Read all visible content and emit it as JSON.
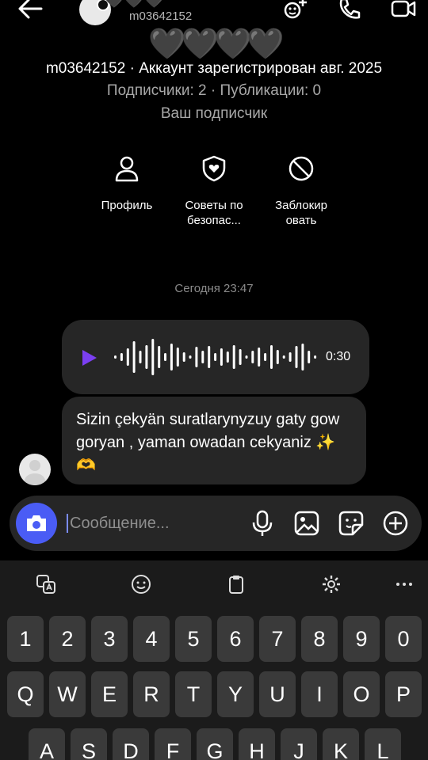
{
  "header": {
    "username_small": "m03642152",
    "top_hearts": "🖤🖤🖤",
    "name_hearts": [
      "🖤",
      "🖤",
      "🖤",
      "🖤"
    ]
  },
  "profile": {
    "account_line": "m03642152 · Аккаунт зарегистрирован авг. 2025",
    "stats_line": "Подписчики: 2 · Публикации: 0",
    "relation": "Ваш подписчик"
  },
  "actions": [
    {
      "label": "Профиль",
      "icon": "person-icon"
    },
    {
      "label": "Советы по безопас...",
      "icon": "shield-heart-icon"
    },
    {
      "label": "Заблокир овать",
      "icon": "block-icon"
    }
  ],
  "chat": {
    "timestamp": "Сегодня 23:47",
    "voice_duration": "0:30",
    "message": "Sizin çekyän suratlarynyzuy gaty gow goryan , yaman owadan cekyaniz ✨🫶"
  },
  "composer": {
    "placeholder": "Сообщение..."
  },
  "keyboard": {
    "tools": [
      "translate-icon",
      "emoji-icon",
      "clipboard-icon",
      "settings-icon",
      "more-icon"
    ],
    "row_numbers": [
      "1",
      "2",
      "3",
      "4",
      "5",
      "6",
      "7",
      "8",
      "9",
      "0"
    ],
    "row_top": [
      "Q",
      "W",
      "E",
      "R",
      "T",
      "Y",
      "U",
      "I",
      "O",
      "P"
    ],
    "row_middle": [
      "A",
      "S",
      "D",
      "F",
      "G",
      "H",
      "J",
      "K",
      "L"
    ]
  },
  "colors": {
    "accent": "#4a5cf5",
    "play": "#7b3ff2",
    "bubble": "#262626"
  }
}
